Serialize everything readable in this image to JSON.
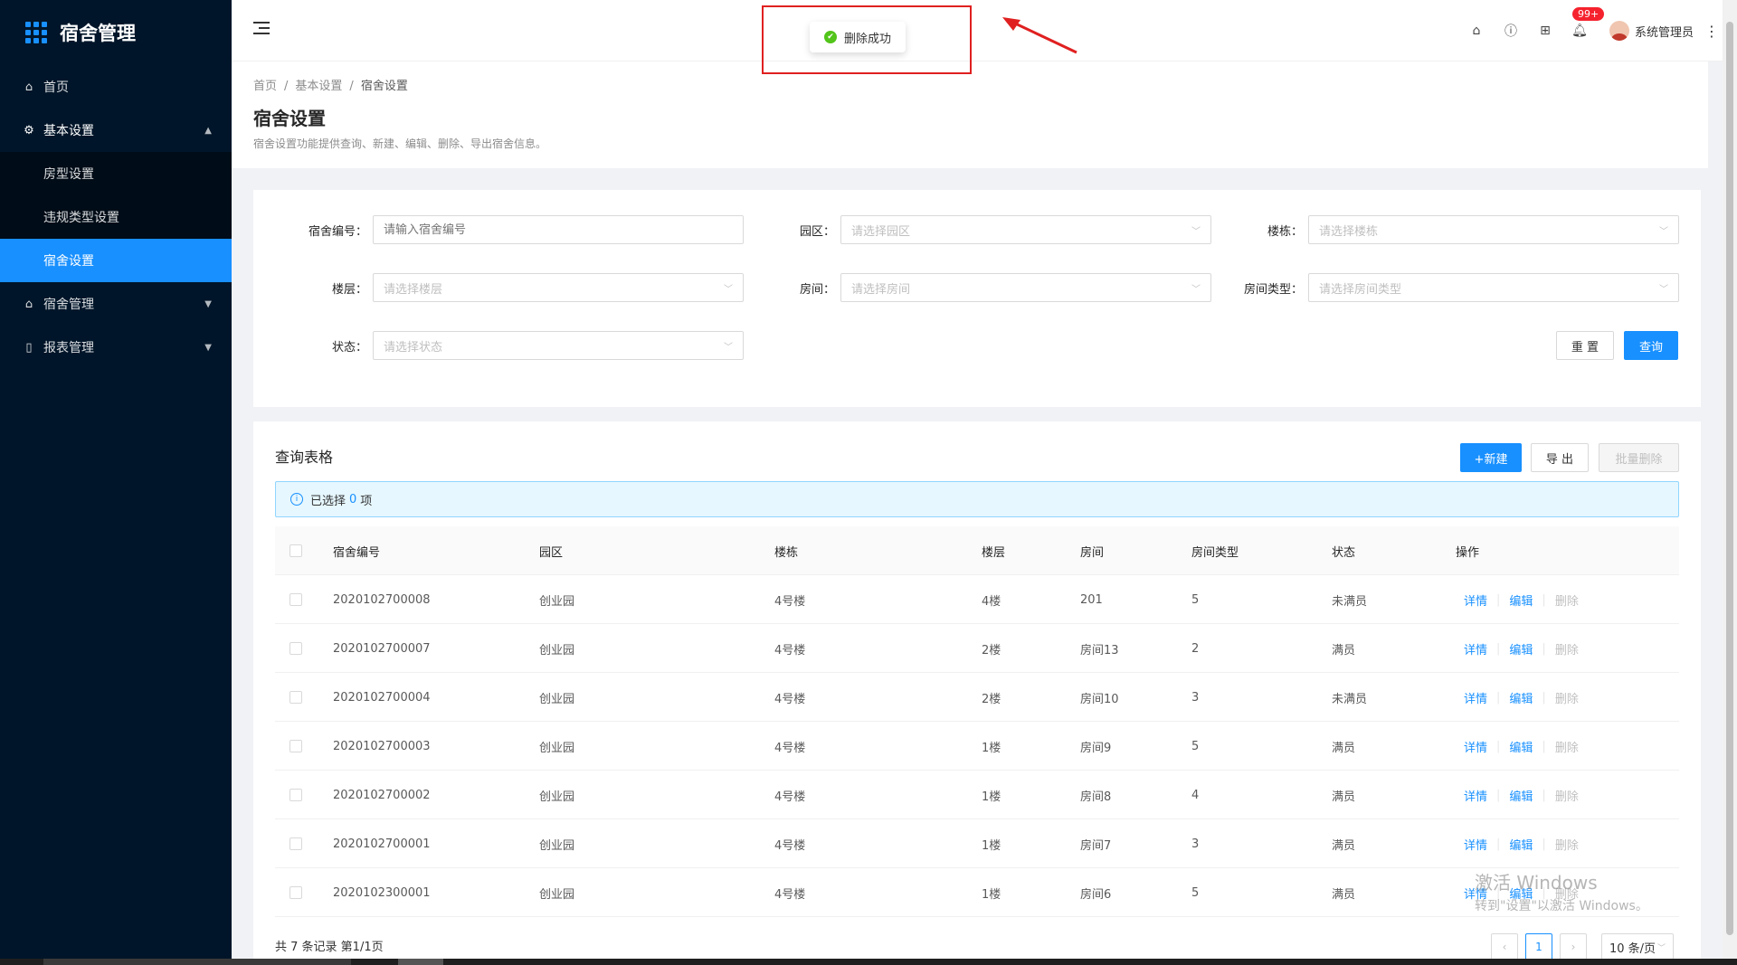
{
  "app": {
    "title": "宿舍管理"
  },
  "sidebar": {
    "items": [
      {
        "label": "首页"
      },
      {
        "label": "基本设置",
        "children": [
          {
            "label": "房型设置"
          },
          {
            "label": "违规类型设置"
          },
          {
            "label": "宿舍设置"
          }
        ]
      },
      {
        "label": "宿舍管理"
      },
      {
        "label": "报表管理"
      }
    ]
  },
  "topbar": {
    "toast": "删除成功",
    "badge": "99+",
    "user": "系统管理员"
  },
  "breadcrumb": [
    "首页",
    "基本设置",
    "宿舍设置"
  ],
  "page": {
    "title": "宿舍设置",
    "desc": "宿舍设置功能提供查询、新建、编辑、删除、导出宿舍信息。"
  },
  "search": {
    "fields": [
      {
        "label": "宿舍编号：",
        "placeholder": "请输入宿舍编号"
      },
      {
        "label": "园区：",
        "placeholder": "请选择园区"
      },
      {
        "label": "楼栋：",
        "placeholder": "请选择楼栋"
      },
      {
        "label": "楼层：",
        "placeholder": "请选择楼层"
      },
      {
        "label": "房间：",
        "placeholder": "请选择房间"
      },
      {
        "label": "房间类型：",
        "placeholder": "请选择房间类型"
      },
      {
        "label": "状态：",
        "placeholder": "请选择状态"
      }
    ],
    "reset": "重 置",
    "query": "查询"
  },
  "table": {
    "title": "查询表格",
    "new": "+新建",
    "export": "导 出",
    "batch_delete": "批量删除",
    "selected_prefix": "已选择",
    "selected_count": "0",
    "selected_suffix": "项",
    "headers": [
      "宿舍编号",
      "园区",
      "楼栋",
      "楼层",
      "房间",
      "房间类型",
      "状态",
      "操作"
    ],
    "rows": [
      [
        "2020102700008",
        "创业园",
        "4号楼",
        "4楼",
        "201",
        "5",
        "未满员"
      ],
      [
        "2020102700007",
        "创业园",
        "4号楼",
        "2楼",
        "房间13",
        "2",
        "满员"
      ],
      [
        "2020102700004",
        "创业园",
        "4号楼",
        "2楼",
        "房间10",
        "3",
        "未满员"
      ],
      [
        "2020102700003",
        "创业园",
        "4号楼",
        "1楼",
        "房间9",
        "5",
        "满员"
      ],
      [
        "2020102700002",
        "创业园",
        "4号楼",
        "1楼",
        "房间8",
        "4",
        "满员"
      ],
      [
        "2020102700001",
        "创业园",
        "4号楼",
        "1楼",
        "房间7",
        "3",
        "满员"
      ],
      [
        "2020102300001",
        "创业园",
        "4号楼",
        "1楼",
        "房间6",
        "5",
        "满员"
      ]
    ],
    "actions": {
      "detail": "详情",
      "edit": "编辑",
      "delete": "删除"
    },
    "total": "共 7 条记录 第1/1页",
    "page": "1",
    "page_size": "10 条/页"
  },
  "watermark": {
    "line1": "激活 Windows",
    "line2": "转到\"设置\"以激活 Windows。"
  },
  "colors": {
    "primary": "#1890ff",
    "sidebar": "#001529",
    "success": "#52c41a",
    "annotation": "#e02020"
  },
  "icons": [
    "home-icon",
    "gear-icon",
    "menu-fold-icon",
    "question-icon",
    "apps-icon",
    "bell-icon",
    "check-circle-icon",
    "info-icon",
    "file-icon"
  ]
}
